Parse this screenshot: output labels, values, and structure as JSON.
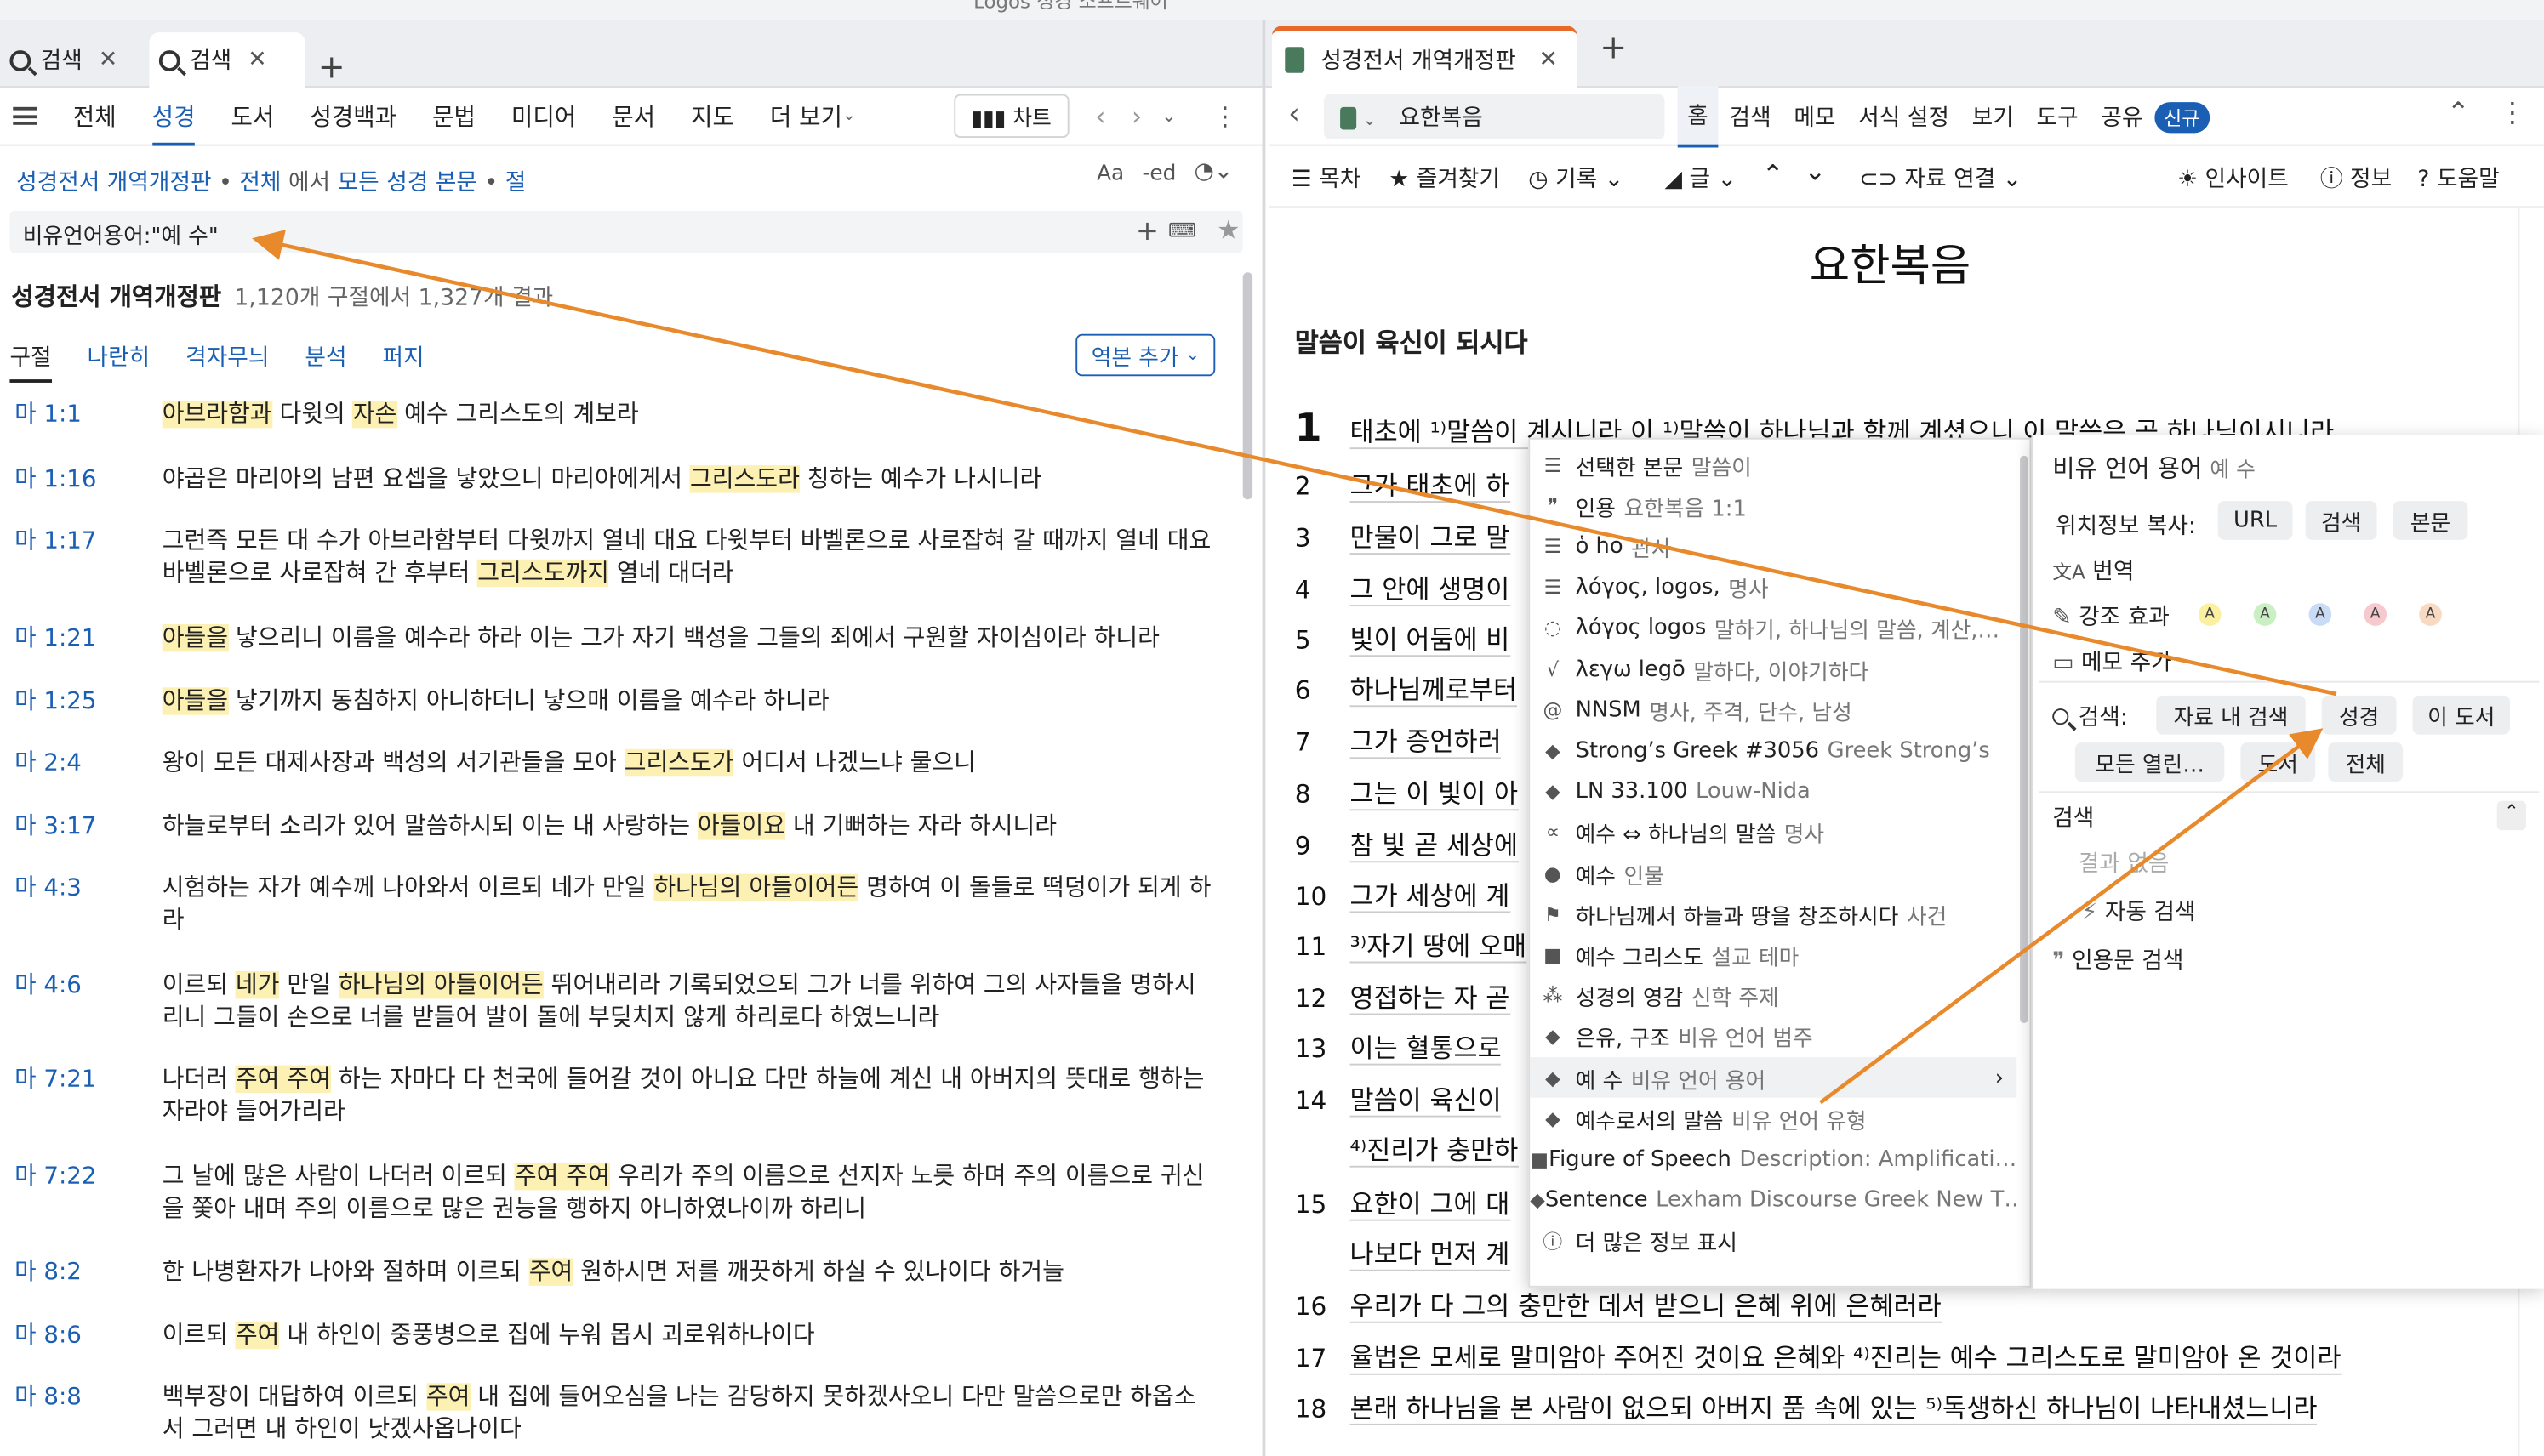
{
  "window": {
    "title": "Logos 성경 소프트웨어"
  },
  "left": {
    "tabs": [
      {
        "label": "검색"
      },
      {
        "label": "검색"
      }
    ],
    "nav": [
      "전체",
      "성경",
      "도서",
      "성경백과",
      "문법",
      "미디어",
      "문서",
      "지도",
      "더 보기"
    ],
    "chart_btn": "차트",
    "crumbs": {
      "bible": "성경전서 개역개정판",
      "sep": "•",
      "all": "전체",
      "in": "에서",
      "scope": "모든 성경 본문",
      "sep2": "•",
      "unit": "절"
    },
    "aa": "Aa",
    "ed": "-ed",
    "search_value": "비유언어용어:\"예 수\"",
    "result_title": "성경전서 개역개정판",
    "result_count": "1,120개 구절에서 1,327개 결과",
    "subtabs": [
      "구절",
      "나란히",
      "격자무늬",
      "분석",
      "퍼지"
    ],
    "add_version": "역본 추가",
    "results": [
      {
        "ref": "마 1:1",
        "parts": [
          [
            "아브라함과",
            1
          ],
          [
            " 다윗의 ",
            0
          ],
          [
            "자손",
            1
          ],
          [
            " 예수 그리스도의 계보라",
            0
          ]
        ]
      },
      {
        "ref": "마 1:16",
        "parts": [
          [
            "야곱은 마리아의 남편 요셉을 낳았으니 마리아에게서 ",
            0
          ],
          [
            "그리스도라",
            1
          ],
          [
            " 칭하는 예수가 나시니라",
            0
          ]
        ]
      },
      {
        "ref": "마 1:17",
        "parts": [
          [
            "그런즉 모든 대 수가 아브라함부터 다윗까지 열네 대요 다윗부터 바벨론으로 사로잡혀 갈 때까지 열네 대요 바벨론으로 사로잡혀 간 후부터 ",
            0
          ],
          [
            "그리스도까지",
            1
          ],
          [
            " 열네 대더라",
            0
          ]
        ]
      },
      {
        "ref": "마 1:21",
        "parts": [
          [
            "아들을",
            1
          ],
          [
            " 낳으리니 이름을 예수라 하라 이는 그가 자기 백성을 그들의 죄에서 구원할 자이심이라 하니라",
            0
          ]
        ]
      },
      {
        "ref": "마 1:25",
        "parts": [
          [
            "아들을",
            1
          ],
          [
            " 낳기까지 동침하지 아니하더니 낳으매 이름을 예수라 하니라",
            0
          ]
        ]
      },
      {
        "ref": "마 2:4",
        "parts": [
          [
            "왕이 모든 대제사장과 백성의 서기관들을 모아 ",
            0
          ],
          [
            "그리스도가",
            1
          ],
          [
            " 어디서 나겠느냐 물으니",
            0
          ]
        ]
      },
      {
        "ref": "마 3:17",
        "parts": [
          [
            "하늘로부터 소리가 있어 말씀하시되 이는 내 사랑하는 ",
            0
          ],
          [
            "아들이요",
            1
          ],
          [
            " 내 기뻐하는 자라 하시니라",
            0
          ]
        ]
      },
      {
        "ref": "마 4:3",
        "parts": [
          [
            "시험하는 자가 예수께 나아와서 이르되 네가 만일 ",
            0
          ],
          [
            "하나님의 아들이어든",
            1
          ],
          [
            " 명하여 이 돌들로 떡덩이가 되게 하라",
            0
          ]
        ]
      },
      {
        "ref": "마 4:6",
        "parts": [
          [
            "이르되 ",
            0
          ],
          [
            "네가",
            1
          ],
          [
            " 만일 ",
            0
          ],
          [
            "하나님의 아들이어든",
            1
          ],
          [
            " 뛰어내리라 기록되었으되 그가 너를 위하여 그의 사자들을 명하시리니 그들이 손으로 너를 받들어 발이 돌에 부딪치지 않게 하리로다 하였느니라",
            0
          ]
        ]
      },
      {
        "ref": "마 7:21",
        "parts": [
          [
            "나더러 ",
            0
          ],
          [
            "주여 주여",
            1
          ],
          [
            " 하는 자마다 다 천국에 들어갈 것이 아니요 다만 하늘에 계신 내 아버지의 뜻대로 행하는 자라야 들어가리라",
            0
          ]
        ]
      },
      {
        "ref": "마 7:22",
        "parts": [
          [
            "그 날에 많은 사람이 나더러 이르되 ",
            0
          ],
          [
            "주여 주여",
            1
          ],
          [
            " 우리가 주의 이름으로 선지자 노릇 하며 주의 이름으로 귀신을 쫓아 내며 주의 이름으로 많은 권능을 행하지 아니하였나이까 하리니",
            0
          ]
        ]
      },
      {
        "ref": "마 8:2",
        "parts": [
          [
            "한 나병환자가 나아와 절하며 이르되 ",
            0
          ],
          [
            "주여",
            1
          ],
          [
            " 원하시면 저를 깨끗하게 하실 수 있나이다 하거늘",
            0
          ]
        ]
      },
      {
        "ref": "마 8:6",
        "parts": [
          [
            "이르되 ",
            0
          ],
          [
            "주여",
            1
          ],
          [
            " 내 하인이 중풍병으로 집에 누워 몹시 괴로워하나이다",
            0
          ]
        ]
      },
      {
        "ref": "마 8:8",
        "parts": [
          [
            "백부장이 대답하여 이르되 ",
            0
          ],
          [
            "주여",
            1
          ],
          [
            " 내 집에 들어오심을 나는 감당하지 못하겠사오니 다만 말씀으로만 하옵소서 그러면 내 하인이 낫겠사옵나이다",
            0
          ]
        ]
      }
    ]
  },
  "right": {
    "tab_label": "성경전서 개역개정판",
    "book": "요한복음",
    "menu": [
      "홈",
      "검색",
      "메모",
      "서식 설정",
      "보기",
      "도구",
      "공유"
    ],
    "new_badge": "신규",
    "tools": [
      "목차",
      "즐겨찾기",
      "기록",
      "글",
      "자료 연결",
      "인사이트",
      "정보",
      "도움말"
    ],
    "doc_title": "요한복음",
    "section_heading": "말씀이 육신이 되시다",
    "verses": [
      {
        "n": "1",
        "t": "태초에 ¹⁾말씀이 계시니라 이 ¹⁾말씀이 하나님과 함께 계셨으니 이 말씀은 곧 하나님이시니라"
      },
      {
        "n": "2",
        "t": "그가 태초에 하"
      },
      {
        "n": "3",
        "t": "만물이 그로 말"
      },
      {
        "n": "4",
        "t": "그 안에 생명이"
      },
      {
        "n": "5",
        "t": "빛이 어둠에 비"
      },
      {
        "n": "6",
        "t": "하나님께로부터"
      },
      {
        "n": "7",
        "t": "그가 증언하러"
      },
      {
        "n": "8",
        "t": "그는 이 빛이 아"
      },
      {
        "n": "9",
        "t": "참 빛 곧 세상에"
      },
      {
        "n": "10",
        "t": "그가 세상에 계"
      },
      {
        "n": "11",
        "t": "³⁾자기 땅에 오매"
      },
      {
        "n": "12",
        "t": "영접하는 자 곧"
      },
      {
        "n": "13",
        "t": "이는 혈통으로"
      },
      {
        "n": "14",
        "t": "말씀이 육신이"
      },
      {
        "n": "",
        "t": "⁴⁾진리가 충만하"
      },
      {
        "n": "15",
        "t": "요한이 그에 대"
      },
      {
        "n": "",
        "t": "나보다 먼저 계"
      },
      {
        "n": "16",
        "t": "우리가 다 그의 충만한 데서 받으니 은혜 위에 은혜러라"
      },
      {
        "n": "17",
        "t": "율법은 모세로 말미암아 주어진 것이요 은혜와 ⁴⁾진리는 예수 그리스도로 말미암아 온 것이라"
      },
      {
        "n": "18",
        "t": "본래 하나님을 본 사람이 없으되 아버지 품 속에 있는 ⁵⁾독생하신 하나님이 나타내셨느니라"
      }
    ]
  },
  "context_menu": [
    {
      "ic": "☰",
      "main": "선택한 본문",
      "sub": "말씀이"
    },
    {
      "ic": "❞",
      "main": "인용",
      "sub": "요한복음 1:1"
    },
    {
      "ic": "☰",
      "main": "ὁ ho",
      "sub": "관사"
    },
    {
      "ic": "☰",
      "main": "λόγος, logos,",
      "sub": "명사"
    },
    {
      "ic": "◌",
      "main": "λόγος logos",
      "sub": "말하기, 하나님의 말씀, 계산,…"
    },
    {
      "ic": "√",
      "main": "λεγω legō",
      "sub": "말하다, 이야기하다"
    },
    {
      "ic": "@",
      "main": "NNSM",
      "sub": "명사, 주격, 단수, 남성"
    },
    {
      "ic": "◆",
      "main": "Strong’s Greek #3056",
      "sub": "Greek Strong’s"
    },
    {
      "ic": "◆",
      "main": "LN 33.100",
      "sub": "Louw-Nida"
    },
    {
      "ic": "∝",
      "main": "예수 ⇔ 하나님의 말씀",
      "sub": "명사"
    },
    {
      "ic": "●",
      "main": "예수",
      "sub": "인물"
    },
    {
      "ic": "⚑",
      "main": "하나님께서 하늘과 땅을 창조하시다",
      "sub": "사건"
    },
    {
      "ic": "■",
      "main": "예수 그리스도",
      "sub": "설교 테마"
    },
    {
      "ic": "⁂",
      "main": "성경의 영감",
      "sub": "신학 주제"
    },
    {
      "ic": "◆",
      "main": "은유, 구조",
      "sub": "비유 언어 범주"
    },
    {
      "ic": "◆",
      "main": "예 수",
      "sub": "비유 언어 용어"
    },
    {
      "ic": "◆",
      "main": "예수로서의 말씀",
      "sub": "비유 언어 유형"
    },
    {
      "ic": "■",
      "main": "Figure of Speech",
      "sub": "Description: Amplificati…"
    },
    {
      "ic": "◆",
      "main": "Sentence",
      "sub": "Lexham Discourse Greek New T…"
    },
    {
      "ic": "ⓘ",
      "main": "더 많은 정보 표시",
      "sub": ""
    }
  ],
  "submenu": {
    "title": "비유 언어 용어",
    "title_sub": "예 수",
    "copy_label": "위치정보 복사:",
    "copy_btns": [
      "URL",
      "검색",
      "본문"
    ],
    "translate": "번역",
    "highlight": "강조 효과",
    "note": "메모 추가",
    "search_label": "검색:",
    "search_btns": [
      "자료 내 검색",
      "성경",
      "이 도서",
      "모든 열린…",
      "도서",
      "전체"
    ],
    "section": "검색",
    "no_results": "결과 없음",
    "auto": "자동 검색",
    "cite": "인용문 검색"
  },
  "colors": {
    "accent": "#1a5fb4",
    "highlight": "#fdf0b3",
    "arrow": "#e8892c",
    "tab_accent": "#e8692c"
  }
}
